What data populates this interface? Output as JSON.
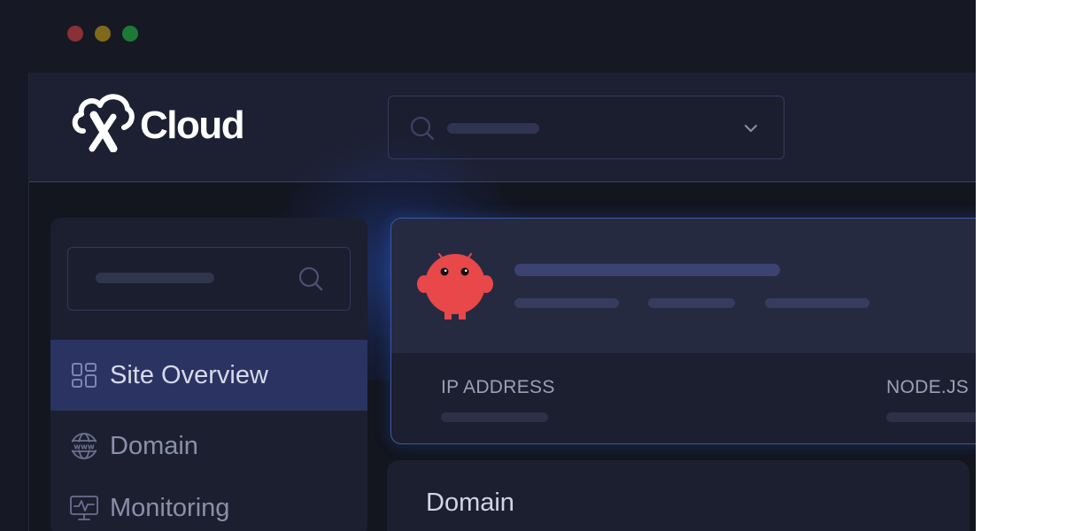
{
  "window": {
    "traffic_lights": [
      "#8a3037",
      "#7f6a1a",
      "#1c7a36"
    ]
  },
  "brand": {
    "name": "Cloud",
    "icon": "x-cloud-logo-icon"
  },
  "header": {
    "search_icon": "search-icon",
    "dropdown_icon": "chevron-down-icon"
  },
  "sidebar": {
    "search_icon": "search-icon",
    "items": [
      {
        "label": "Site Overview",
        "icon": "grid-dashboard-icon",
        "active": true
      },
      {
        "label": "Domain",
        "icon": "globe-www-icon",
        "active": false
      },
      {
        "label": "Monitoring",
        "icon": "monitor-pulse-icon",
        "active": false
      }
    ]
  },
  "site_card": {
    "avatar_icon": "red-creature-avatar-icon",
    "fields": [
      {
        "label": "IP ADDRESS"
      },
      {
        "label": "NODE.JS"
      }
    ]
  },
  "domain_section": {
    "title": "Domain"
  },
  "colors": {
    "accent": "#2a3362",
    "highlight_border": "#3e58a8",
    "avatar": "#e8484a",
    "background": "#13151f"
  }
}
